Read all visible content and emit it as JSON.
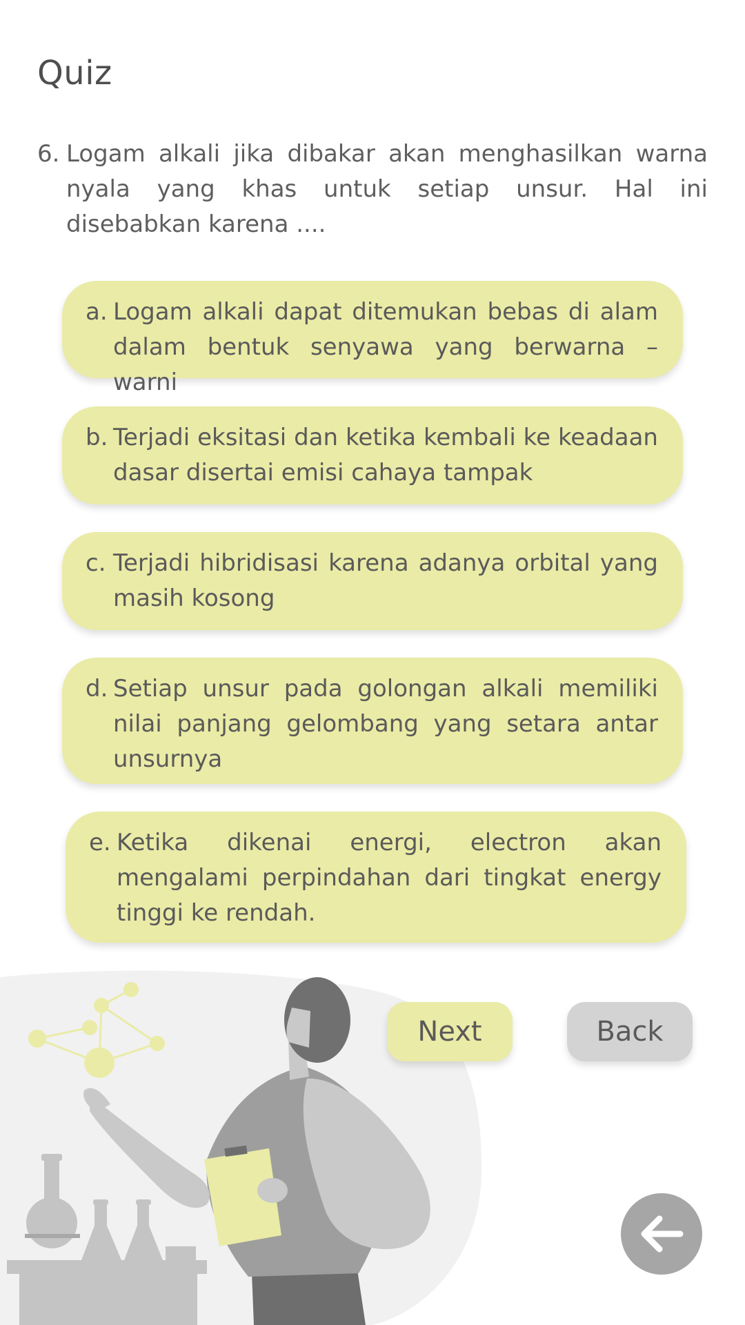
{
  "header": {
    "title": "Quiz"
  },
  "question": {
    "number": "6.",
    "text": "Logam alkali jika dibakar akan menghasilkan warna nyala yang khas untuk setiap unsur. Hal ini disebabkan karena ...."
  },
  "options": [
    {
      "letter": "a.",
      "text": "Logam alkali dapat ditemukan bebas di alam dalam bentuk senyawa yang berwarna – warni"
    },
    {
      "letter": "b.",
      "text": "Terjadi eksitasi dan ketika kembali ke keadaan dasar disertai emisi cahaya tampak"
    },
    {
      "letter": "c.",
      "text": "Terjadi hibridisasi karena adanya orbital yang masih kosong"
    },
    {
      "letter": "d.",
      "text": "Setiap unsur pada golongan alkali memiliki nilai panjang gelombang yang setara antar unsurnya"
    },
    {
      "letter": "e.",
      "text": "Ketika dikenai energi, electron akan mengalami perpindahan dari tingkat energy tinggi ke rendah."
    }
  ],
  "buttons": {
    "next_label": "Next",
    "back_label": "Back"
  },
  "icons": {
    "back_arrow": "arrow-left-icon",
    "illustration": "scientist-illustration"
  },
  "colors": {
    "option_bg": "#eaeba6",
    "back_bg": "#d3d3d3",
    "fab_bg": "#a6a6a6"
  }
}
